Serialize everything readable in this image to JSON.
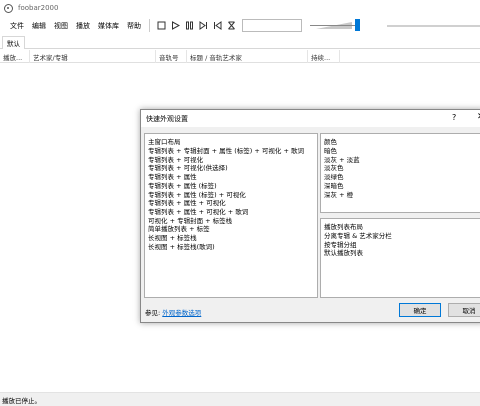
{
  "window": {
    "title": "foobar2000"
  },
  "menu": [
    "文件",
    "编辑",
    "视图",
    "播放",
    "媒体库",
    "帮助"
  ],
  "toolbar": {
    "buttons": [
      {
        "icon": "stop-icon",
        "glyph": "□"
      },
      {
        "icon": "play-icon",
        "glyph": "▷"
      },
      {
        "icon": "pause-icon",
        "glyph": "⏸"
      },
      {
        "icon": "next-icon",
        "glyph": "⏭"
      },
      {
        "icon": "previous-icon",
        "glyph": "⏮"
      },
      {
        "icon": "random-icon",
        "glyph": "⧗"
      }
    ],
    "volume_level": 1.0
  },
  "tabs": {
    "active": "默认"
  },
  "columns": [
    "播放...",
    "艺术家/专辑",
    "音轨号",
    "标题 / 音轨艺术家",
    "持续..."
  ],
  "status": "播放已停止。",
  "dialog": {
    "title": "快速外观设置",
    "help": "?",
    "close": "✕",
    "layouts": {
      "heading": "主窗口布局",
      "items": [
        "专辑列表 + 专辑封面 + 属性 (标签) + 可视化 + 歌词",
        "专辑列表 + 可视化",
        "专辑列表 + 可视化(供选择)",
        "专辑列表 + 属性",
        "专辑列表 + 属性 (标签)",
        "专辑列表 + 属性 (标签) + 可视化",
        "专辑列表 + 属性 + 可视化",
        "专辑列表 + 属性 + 可视化 + 歌词",
        "可视化 + 专辑封面 + 标签栈",
        "简单播放列表 + 标签",
        "长视图 + 标签栈",
        "长视图 + 标签栈(歌词)"
      ]
    },
    "colors": {
      "heading": "颜色",
      "items": [
        "暗色",
        "淡灰 + 淡蓝",
        "淡灰色",
        "淡绿色",
        "深暗色",
        "深灰 + 橙"
      ]
    },
    "playlist_layouts": {
      "heading": "播放列表布局",
      "items": [
        "分离专辑 & 艺术家分栏",
        "按专辑分组",
        "默认播放列表"
      ]
    },
    "ref_label": "参见:",
    "ref_link": "外观参数选项",
    "ok": "确定",
    "cancel": "取消"
  },
  "colors": {
    "accent": "#0078d7",
    "link": "#0066cc"
  }
}
